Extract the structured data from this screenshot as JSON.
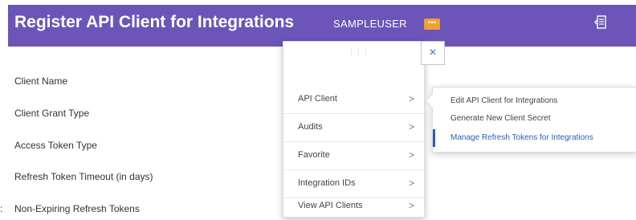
{
  "header": {
    "title": "Register API Client for Integrations",
    "user": "SAMPLEUSER",
    "related_actions_icon": "ellipsis-icon",
    "action_icon": "export-icon",
    "background": "#6b55b8"
  },
  "fields": [
    {
      "label": "Client Name"
    },
    {
      "label": "Client Grant Type"
    },
    {
      "label": "Access Token Type"
    },
    {
      "label": "Refresh Token Timeout (in days)"
    },
    {
      "label": "Non-Expiring Refresh Tokens"
    }
  ],
  "left_fragment": ":",
  "menu": {
    "close_glyph": "×",
    "items": [
      {
        "label": "API Client",
        "chevron": ">"
      },
      {
        "label": "Audits",
        "chevron": ">"
      },
      {
        "label": "Favorite",
        "chevron": ">"
      },
      {
        "label": "Integration IDs",
        "chevron": ">"
      },
      {
        "label": "View API Clients",
        "chevron": ">"
      }
    ]
  },
  "submenu": {
    "items": [
      {
        "label": "Edit API Client for Integrations"
      },
      {
        "label": "Generate New Client Secret"
      },
      {
        "label": "Manage Refresh Tokens for Integrations",
        "active": true
      }
    ],
    "accent": "#2a5fb8"
  }
}
